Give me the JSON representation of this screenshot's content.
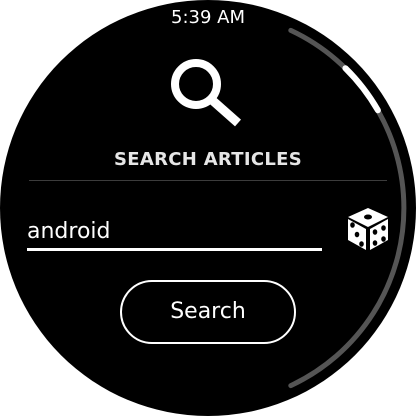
{
  "status_bar": {
    "time": "5:39 AM"
  },
  "header": {
    "title": "SEARCH ARTICLES",
    "icon": "search-icon"
  },
  "search": {
    "value": "android"
  },
  "actions": {
    "search_label": "Search",
    "random_icon": "dice-icon"
  },
  "scroll": {
    "position_fraction": 0.15,
    "visible_fraction": 0.12
  },
  "colors": {
    "background": "#000000",
    "text": "#ffffff",
    "title": "#e6e6e6",
    "scroll_track": "#555555",
    "scroll_thumb": "#ffffff"
  }
}
